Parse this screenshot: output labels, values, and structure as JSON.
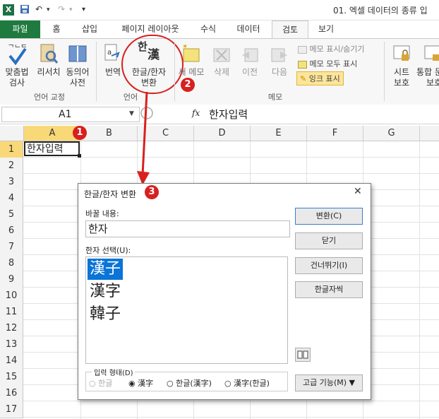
{
  "window": {
    "title": "01. 엑셀 데이터의 종류 입",
    "qat_undo": "↶",
    "qat_redo": "↷",
    "qat_more": "▾"
  },
  "tabs": [
    "파일",
    "홈",
    "삽입",
    "페이지 레이아웃",
    "수식",
    "데이터",
    "검토",
    "보기"
  ],
  "ribbon": {
    "proof_group": {
      "label": "언어 교정",
      "spell_l1": "맞춤법",
      "spell_l2": "검사",
      "research": "리서치",
      "thesaurus_l1": "동의어",
      "thesaurus_l2": "사전"
    },
    "lang_group": {
      "label": "언어",
      "translate": "번역",
      "hanja_l1": "한글/한자",
      "hanja_l2": "변환",
      "hanja_icon_text": "한",
      "hanja_icon_text2": "漢"
    },
    "memo_group": {
      "label": "메모",
      "new_memo": "새 메모",
      "delete": "삭제",
      "prev": "이전",
      "next": "다음",
      "show_hide": "메모 표시/숨기기",
      "show_all": "메모 모두 표시",
      "ink": "잉크 표시"
    },
    "protect_group": {
      "sheet_l1": "시트",
      "sheet_l2": "보호",
      "wb_l1": "통합 문",
      "wb_l2": "보호"
    }
  },
  "formula_bar": {
    "name_box": "A1",
    "fx": "fx",
    "content": "한자입력"
  },
  "grid": {
    "columns": [
      "A",
      "B",
      "C",
      "D",
      "E",
      "F",
      "G"
    ],
    "rows": [
      "1",
      "2",
      "3",
      "4",
      "5",
      "6",
      "7",
      "8",
      "9",
      "10",
      "11",
      "12",
      "13",
      "14",
      "15",
      "16",
      "17"
    ],
    "cell_a1": "한자입력"
  },
  "dialog": {
    "title": "한글/한자 변환",
    "close": "✕",
    "replace_label": "바꿀 내용:",
    "replace_value": "한자",
    "select_label": "한자 선택(U):",
    "options": [
      "漢子",
      "漢字",
      "韓子"
    ],
    "btn_convert": "변환(C)",
    "btn_close": "닫기",
    "btn_skip": "건너뛰기(I)",
    "btn_dict": "한글자씩",
    "btn_advanced": "고급 기능(M) ▼",
    "input_form_label": "입력 형태(D)",
    "radios": [
      "한글",
      "漢字",
      "한글(漢字)",
      "漢字(한글)"
    ]
  },
  "callouts": [
    "1",
    "2",
    "3"
  ],
  "colors": {
    "excel_green": "#1f7a3f",
    "callout_red": "#d8201f",
    "selection_blue": "#0a74d8"
  }
}
